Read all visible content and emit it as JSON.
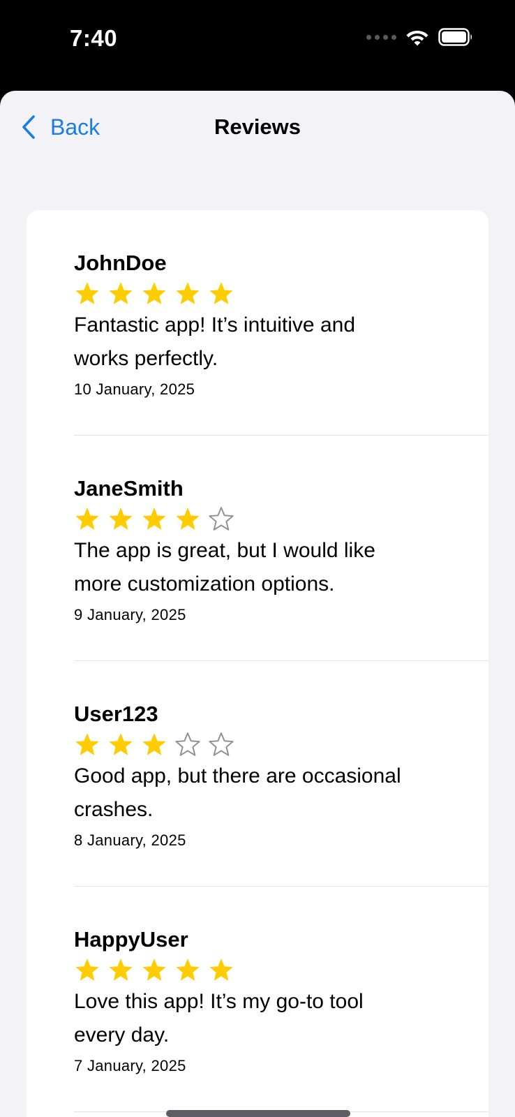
{
  "status_bar": {
    "time": "7:40"
  },
  "nav": {
    "back_label": "Back",
    "title": "Reviews"
  },
  "colors": {
    "accent": "#1a7ee0",
    "star_filled": "#ffcc00",
    "star_empty": "#8e8e93",
    "background": "#f2f2f7",
    "card": "#ffffff"
  },
  "reviews": [
    {
      "user": "JohnDoe",
      "rating": 5,
      "max_rating": 5,
      "text": "Fantastic app! It’s intuitive and works perfectly.",
      "date": "10 January, 2025"
    },
    {
      "user": "JaneSmith",
      "rating": 4,
      "max_rating": 5,
      "text": "The app is great, but I would like more customization options.",
      "date": "9 January, 2025"
    },
    {
      "user": "User123",
      "rating": 3,
      "max_rating": 5,
      "text": "Good app, but there are occasional crashes.",
      "date": "8 January, 2025"
    },
    {
      "user": "HappyUser",
      "rating": 5,
      "max_rating": 5,
      "text": "Love this app! It’s my go-to tool every day.",
      "date": "7 January, 2025"
    }
  ]
}
